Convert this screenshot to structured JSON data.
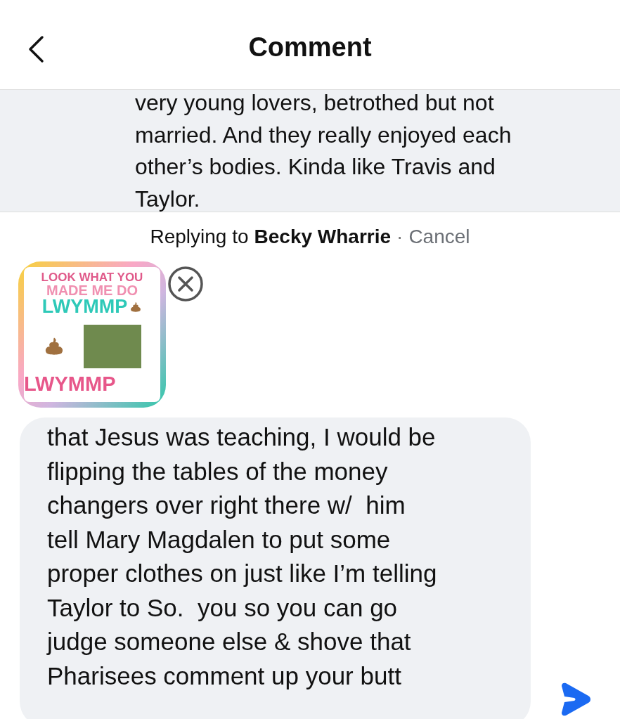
{
  "header": {
    "back_icon": true,
    "title": "Comment"
  },
  "parent_comment": {
    "text": "very young lovers, betrothed but not\nmarried. And they really enjoyed each\nother’s bodies. Kinda like Travis and\nTaylor."
  },
  "reply_banner": {
    "prefix": "Replying to",
    "name": "Becky Wharrie",
    "separator": "·",
    "cancel": "Cancel"
  },
  "attachment": {
    "lines": [
      "LOOK WHAT YOU",
      "MADE ME DO",
      "LWYMMP",
      "LWYMMP"
    ]
  },
  "composer": {
    "value": "that Jesus was teaching, I would be\nflipping the tables of the money\nchangers over right there w/  him\ntell Mary Magdalen to put some\nproper clothes on just like I’m telling\nTaylor to So.  you so you can go\njudge someone else & shove that\nPharisees comment up your butt"
  }
}
